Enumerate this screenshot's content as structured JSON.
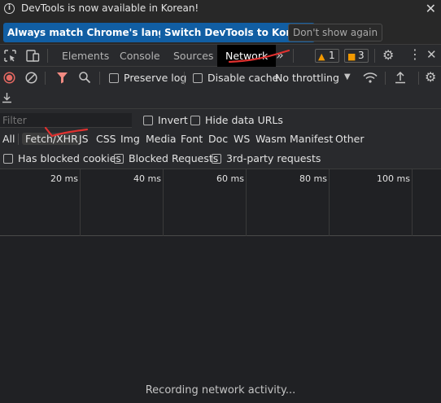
{
  "infobar": {
    "message": "DevTools is now available in Korean!",
    "btn_match": "Always match Chrome's language",
    "btn_switch": "Switch DevTools to Korean",
    "btn_dismiss": "Don't show again"
  },
  "tabs": {
    "elements": "Elements",
    "console": "Console",
    "sources": "Sources",
    "network": "Network",
    "warnings_count": "1",
    "messages_count": "3"
  },
  "toolbar": {
    "preserve_log": "Preserve log",
    "disable_cache": "Disable cache",
    "throttling": "No throttling"
  },
  "filter": {
    "placeholder": "Filter",
    "invert": "Invert",
    "hide_data_urls": "Hide data URLs",
    "types": [
      "All",
      "Fetch/XHR",
      "JS",
      "CSS",
      "Img",
      "Media",
      "Font",
      "Doc",
      "WS",
      "Wasm",
      "Manifest",
      "Other"
    ],
    "active_type": "Fetch/XHR",
    "has_blocked_cookies": "Has blocked cookies",
    "blocked_requests": "Blocked Requests",
    "third_party": "3rd-party requests"
  },
  "timeline": {
    "ticks": [
      "20 ms",
      "40 ms",
      "60 ms",
      "80 ms",
      "100 ms"
    ]
  },
  "status": {
    "recording": "Recording network activity..."
  },
  "colors": {
    "primary_button": "#115ea3",
    "record_red": "#e46962",
    "filter_red": "#f28b82",
    "warning_orange": "#f29900"
  }
}
